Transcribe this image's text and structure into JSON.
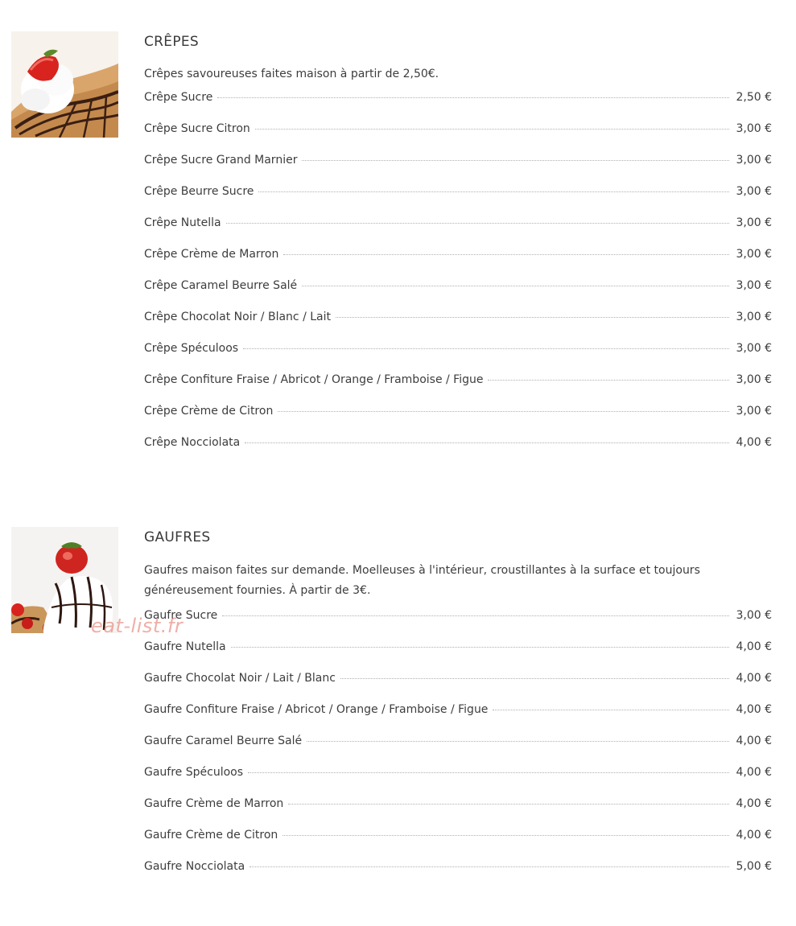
{
  "sections": [
    {
      "title": "CRÊPES",
      "description": "Crêpes savoureuses faites maison à partir de 2,50€.",
      "image_icon": "crepe-photo",
      "items": [
        {
          "name": "Crêpe Sucre",
          "price": "2,50 €"
        },
        {
          "name": "Crêpe Sucre Citron",
          "price": "3,00 €"
        },
        {
          "name": "Crêpe Sucre Grand Marnier",
          "price": "3,00 €"
        },
        {
          "name": "Crêpe Beurre Sucre",
          "price": "3,00 €"
        },
        {
          "name": "Crêpe Nutella",
          "price": "3,00 €"
        },
        {
          "name": "Crêpe Crème de Marron",
          "price": "3,00 €"
        },
        {
          "name": "Crêpe Caramel Beurre Salé",
          "price": "3,00 €"
        },
        {
          "name": "Crêpe Chocolat Noir / Blanc / Lait",
          "price": "3,00 €"
        },
        {
          "name": "Crêpe Spéculoos",
          "price": "3,00 €"
        },
        {
          "name": "Crêpe Confiture Fraise / Abricot / Orange / Framboise / Figue",
          "price": "3,00 €"
        },
        {
          "name": "Crêpe Crème de Citron",
          "price": "3,00 €"
        },
        {
          "name": "Crêpe Nocciolata",
          "price": "4,00 €"
        }
      ]
    },
    {
      "title": "GAUFRES",
      "description": "Gaufres maison faites sur demande. Moelleuses à l'intérieur, croustillantes à la surface et toujours généreusement fournies. À partir de 3€.",
      "image_icon": "gaufre-photo",
      "items": [
        {
          "name": "Gaufre Sucre",
          "price": "3,00 €"
        },
        {
          "name": "Gaufre Nutella",
          "price": "4,00 €"
        },
        {
          "name": "Gaufre Chocolat Noir / Lait / Blanc",
          "price": "4,00 €"
        },
        {
          "name": "Gaufre Confiture Fraise / Abricot / Orange / Framboise / Figue",
          "price": "4,00 €"
        },
        {
          "name": "Gaufre Caramel Beurre Salé",
          "price": "4,00 €"
        },
        {
          "name": "Gaufre Spéculoos",
          "price": "4,00 €"
        },
        {
          "name": "Gaufre Crème de Marron",
          "price": "4,00 €"
        },
        {
          "name": "Gaufre Crème de Citron",
          "price": "4,00 €"
        },
        {
          "name": "Gaufre Nocciolata",
          "price": "5,00 €"
        }
      ]
    }
  ],
  "watermark": "eat-list.fr",
  "colors": {
    "text": "#3d3d3d",
    "dots": "#b0b0b0",
    "watermark": "#e26e5f"
  }
}
